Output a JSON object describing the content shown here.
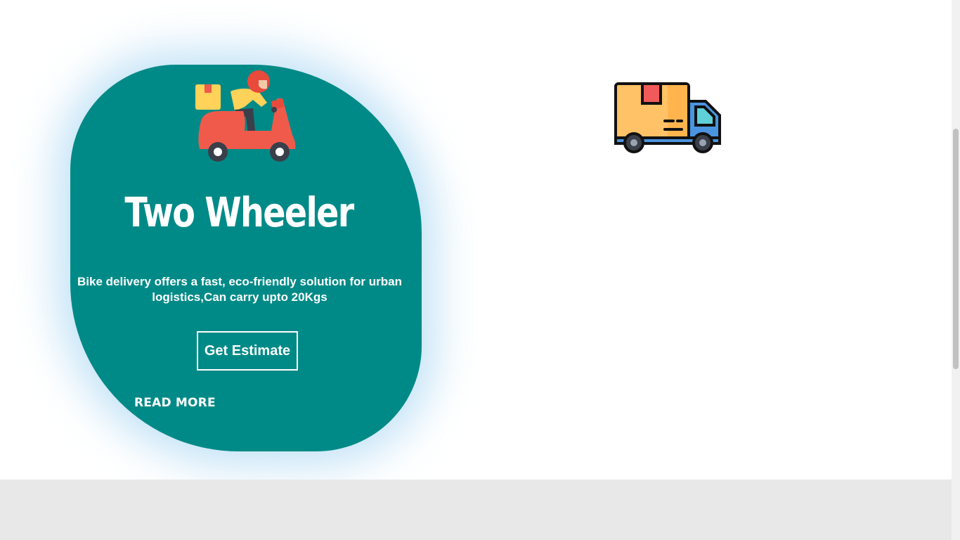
{
  "card": {
    "title": "Two Wheeler",
    "description": "Bike delivery offers a fast, eco-friendly solution for urban logistics,Can carry upto 20Kgs",
    "estimate_label": "Get Estimate",
    "read_more_label": "READ MORE",
    "icon": "scooter-delivery-icon"
  },
  "second_card": {
    "icon": "delivery-truck-icon"
  },
  "colors": {
    "card_bg": "#008a87",
    "footer_bg": "#e8e8e8",
    "glow": "#78beeb"
  }
}
